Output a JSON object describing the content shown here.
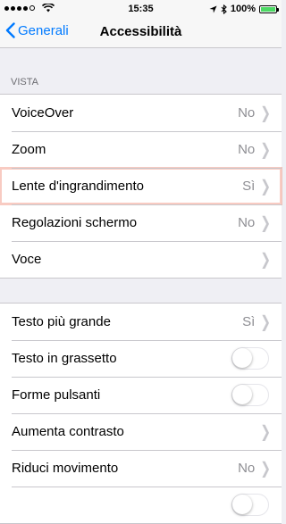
{
  "status_bar": {
    "time": "15:35",
    "battery": "100%",
    "location_icon": "location-arrow-icon",
    "bluetooth_icon": "bluetooth-icon",
    "signal_bars_filled": 4,
    "signal_bars_total": 5
  },
  "nav": {
    "back_label": "Generali",
    "title": "Accessibilità"
  },
  "section_vista": {
    "header": "VISTA",
    "rows": [
      {
        "label": "VoiceOver",
        "value": "No"
      },
      {
        "label": "Zoom",
        "value": "No"
      },
      {
        "label": "Lente d'ingrandimento",
        "value": "Sì"
      },
      {
        "label": "Regolazioni schermo",
        "value": "No"
      },
      {
        "label": "Voce",
        "value": ""
      }
    ]
  },
  "section_text": {
    "rows": [
      {
        "label": "Testo più grande",
        "value": "Sì"
      },
      {
        "label": "Testo in grassetto",
        "toggle": false
      },
      {
        "label": "Forme pulsanti",
        "toggle": false
      },
      {
        "label": "Aumenta contrasto",
        "value": ""
      },
      {
        "label": "Riduci movimento",
        "value": "No"
      }
    ]
  },
  "colors": {
    "accent": "#007aff",
    "battery_fill": "#4cd964",
    "highlight_outline": "#f08c78"
  }
}
